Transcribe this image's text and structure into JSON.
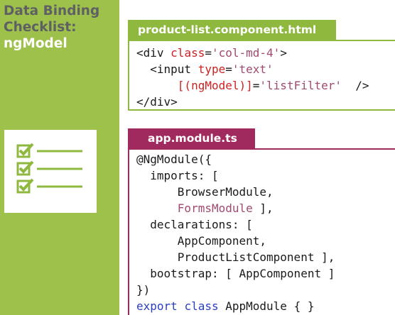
{
  "sidebar": {
    "title_line1": "Data Binding",
    "title_line2": "Checklist:",
    "title_line3": "ngModel",
    "accent_color": "#9dc14b",
    "icon": "checklist-icon"
  },
  "template_file": {
    "tab_label": "product-list.component.html",
    "color": "#8fb83f",
    "lines": [
      [
        "<div ",
        "class",
        "=",
        "'col-md-4'",
        ">"
      ],
      [
        "  <input ",
        "type",
        "=",
        "'text'"
      ],
      [
        "      ",
        "[(ngModel)]",
        "=",
        "'listFilter'",
        "  />"
      ],
      [
        "</div>"
      ]
    ]
  },
  "module_file": {
    "tab_label": "app.module.ts",
    "color": "#a02a5e",
    "lines": {
      "l1": "@NgModule({",
      "l2": "  imports: [",
      "l3": "      BrowserModule,",
      "l4_pre": "      ",
      "l4_hl": "FormsModule",
      "l4_post": " ],",
      "l5": "  declarations: [",
      "l6": "      AppComponent,",
      "l7": "      ProductListComponent ],",
      "l8": "  bootstrap: [ AppComponent ]",
      "l9": "})",
      "l10_kw1": "export",
      "l10_sp1": " ",
      "l10_kw2": "class",
      "l10_rest": " AppModule { }"
    }
  }
}
